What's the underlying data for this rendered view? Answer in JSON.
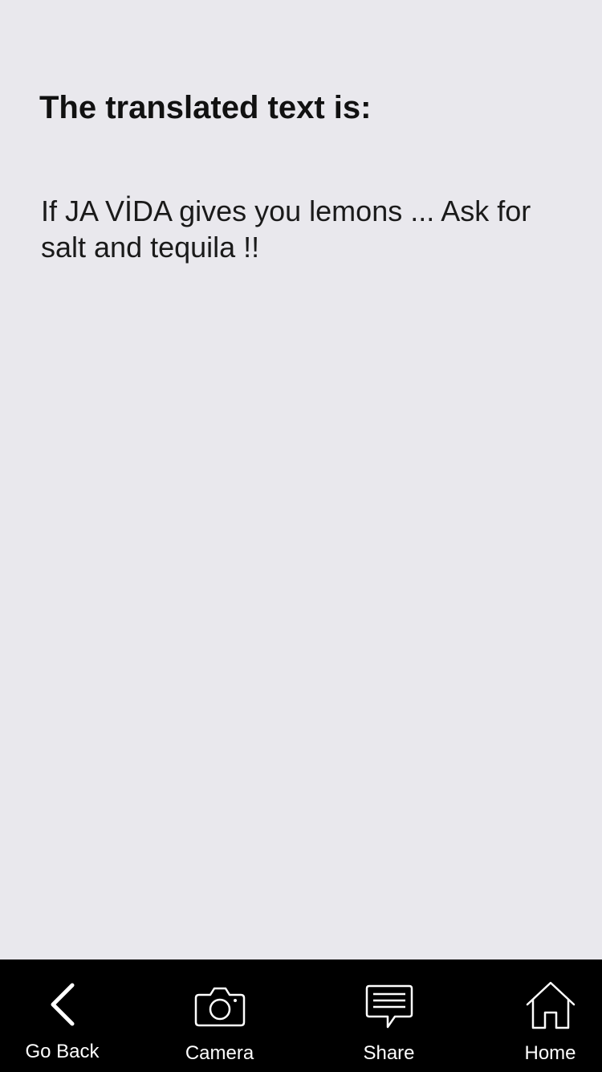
{
  "main": {
    "heading": "The translated text is:",
    "translated_text": "If JA VİDA gives you lemons ... Ask for salt and tequila !!"
  },
  "tabbar": {
    "items": [
      {
        "label": "Go Back",
        "icon": "chevron-left-icon"
      },
      {
        "label": "Camera",
        "icon": "camera-icon"
      },
      {
        "label": "Share",
        "icon": "chat-bubble-icon"
      },
      {
        "label": "Home",
        "icon": "home-icon"
      }
    ]
  },
  "colors": {
    "background": "#e9e8ed",
    "tabbar_background": "#000000",
    "tabbar_foreground": "#ffffff",
    "text": "#111111"
  }
}
